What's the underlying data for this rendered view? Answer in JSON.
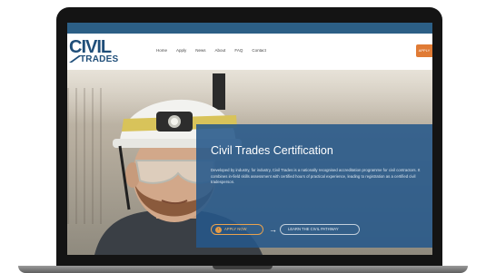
{
  "topbar": {
    "text": ""
  },
  "logo": {
    "line1": "CIVIL",
    "line2": "TRADES"
  },
  "nav": {
    "items": [
      "Home",
      "Apply",
      "News",
      "About",
      "FAQ",
      "Contact"
    ]
  },
  "header": {
    "cta_label": "APPLY"
  },
  "hero": {
    "title": "Civil Trades Certification",
    "body": "Developed by industry, for industry, Civil Trades is a nationally recognised accreditation programme for civil contractors. It combines in-field skills assessment with certified hours of practical experience, leading to registration as a certified civil tradesperson.",
    "apply_label": "APPLY NOW",
    "learn_label": "LEARN THE CIVIL PATHWAY"
  },
  "colors": {
    "brand": "#1f4e79",
    "accent": "#e07b35",
    "panel": "#25588a"
  }
}
